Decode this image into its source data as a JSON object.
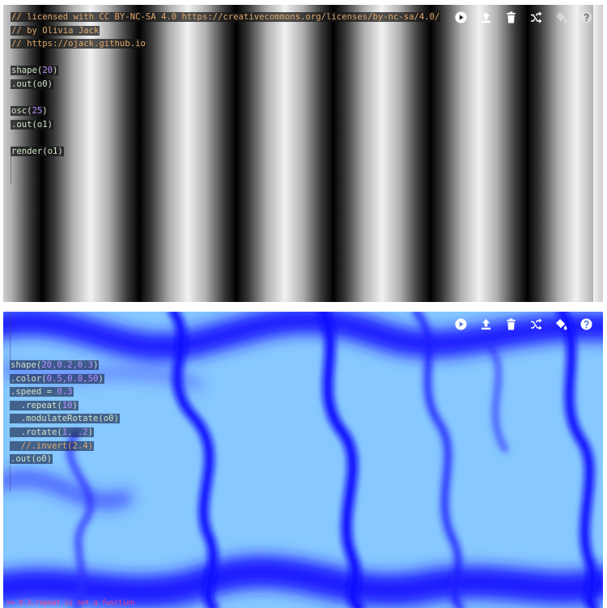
{
  "top_panel": {
    "toolbar": {
      "icons": [
        "play-icon",
        "upload-icon",
        "trash-icon",
        "shuffle-icon",
        "paint-bucket-icon",
        "help-icon"
      ]
    },
    "code_lines": [
      [
        {
          "t": "// licensed with CC BY-NC-SA 4.0 https://creativecommons.org/licenses/by-nc-sa/4.0/",
          "c": "comment"
        }
      ],
      [
        {
          "t": "// by Olivia Jack",
          "c": "comment"
        }
      ],
      [
        {
          "t": "// https://ojack.github.io",
          "c": "comment"
        }
      ],
      [],
      [
        {
          "t": "shape(",
          "c": "fn"
        },
        {
          "t": "20",
          "c": "num"
        },
        {
          "t": ")",
          "c": "fn"
        }
      ],
      [
        {
          "t": ".out(o0)",
          "c": "fn"
        }
      ],
      [],
      [
        {
          "t": "osc(",
          "c": "fn"
        },
        {
          "t": "25",
          "c": "num"
        },
        {
          "t": ")",
          "c": "fn"
        }
      ],
      [
        {
          "t": ".out(o1)",
          "c": "fn"
        }
      ],
      [],
      [
        {
          "t": "render(o1)",
          "c": "fn"
        }
      ]
    ]
  },
  "bottom_panel": {
    "toolbar": {
      "icons": [
        "play-icon",
        "upload-icon",
        "trash-icon",
        "shuffle-icon",
        "paint-bucket-icon",
        "help-icon"
      ]
    },
    "code_lines": [
      [
        {
          "t": "shape(",
          "c": "fn"
        },
        {
          "t": "20,0.2,0.3",
          "c": "num"
        },
        {
          "t": ")",
          "c": "fn"
        }
      ],
      [
        {
          "t": ".color(",
          "c": "fn"
        },
        {
          "t": "0.5,0.8,50",
          "c": "num"
        },
        {
          "t": ")",
          "c": "fn"
        }
      ],
      [
        {
          "t": ".speed = ",
          "c": "fn"
        },
        {
          "t": "0.3",
          "c": "num"
        }
      ],
      [
        {
          "t": "  .repeat(",
          "c": "fn"
        },
        {
          "t": "10",
          "c": "num"
        },
        {
          "t": ")",
          "c": "fn"
        }
      ],
      [
        {
          "t": "  .modulateRotate(o0)",
          "c": "fn"
        }
      ],
      [
        {
          "t": "  .rotate(",
          "c": "fn"
        },
        {
          "t": "1, .2",
          "c": "num"
        },
        {
          "t": ")",
          "c": "fn"
        }
      ],
      [
        {
          "t": "  //.invert(2.4)",
          "c": "comment"
        }
      ],
      [
        {
          "t": ".out(o0)",
          "c": "fn"
        }
      ]
    ],
    "error_message": ">> 0.3.repeat is not a function"
  }
}
